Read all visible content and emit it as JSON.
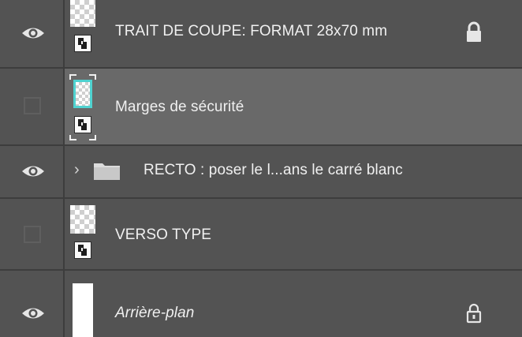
{
  "layers": [
    {
      "name": "TRAIT DE COUPE: FORMAT 28x70 mm",
      "visible": true,
      "type": "smart-object",
      "locked": true,
      "lock_icon": "lock-solid-icon",
      "selected": false
    },
    {
      "name": "Marges de sécurité",
      "visible": false,
      "type": "smart-object",
      "selected": true
    },
    {
      "name": "RECTO : poser le l...ans le carré blanc",
      "visible": true,
      "type": "group",
      "expanded": false,
      "chevron": "›",
      "selected": false
    },
    {
      "name": "VERSO TYPE",
      "visible": false,
      "type": "smart-object",
      "selected": false
    },
    {
      "name": "Arrière-plan",
      "visible": true,
      "type": "background",
      "italic": true,
      "locked": true,
      "lock_icon": "lock-outline-icon",
      "selected": false
    }
  ],
  "colors": {
    "panel_bg": "#535353",
    "selected_row_bg": "#696969",
    "separator": "#3d3d3d",
    "text": "#f0f0f0",
    "selection_frame": "#4fd2d0"
  }
}
